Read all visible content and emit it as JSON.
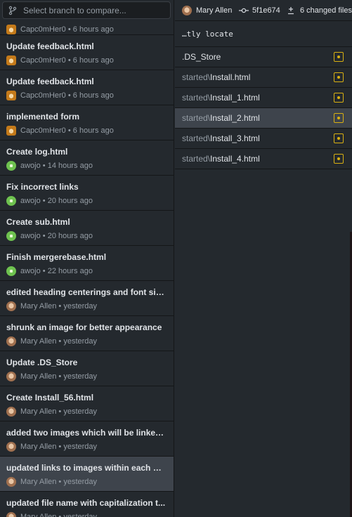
{
  "branch_selector": {
    "placeholder": "Select branch to compare..."
  },
  "commits": [
    {
      "title": "",
      "author": "Capc0mHer0",
      "time": "6 hours ago",
      "avatar": "capc0mher0-avatar"
    },
    {
      "title": "Update feedback.html",
      "author": "Capc0mHer0",
      "time": "6 hours ago",
      "avatar": "capc0mher0-avatar"
    },
    {
      "title": "Update feedback.html",
      "author": "Capc0mHer0",
      "time": "6 hours ago",
      "avatar": "capc0mher0-avatar"
    },
    {
      "title": "implemented form",
      "author": "Capc0mHer0",
      "time": "6 hours ago",
      "avatar": "capc0mher0-avatar"
    },
    {
      "title": "Create log.html",
      "author": "awojo",
      "time": "14 hours ago",
      "avatar": "awojo-avatar"
    },
    {
      "title": "Fix incorrect links",
      "author": "awojo",
      "time": "20 hours ago",
      "avatar": "awojo-avatar"
    },
    {
      "title": "Create sub.html",
      "author": "awojo",
      "time": "20 hours ago",
      "avatar": "awojo-avatar"
    },
    {
      "title": "Finish mergerebase.html",
      "author": "awojo",
      "time": "22 hours ago",
      "avatar": "awojo-avatar"
    },
    {
      "title": "edited heading centerings and font siz...",
      "author": "Mary Allen",
      "time": "yesterday",
      "avatar": "mary-allen-avatar"
    },
    {
      "title": "shrunk an image for better appearance",
      "author": "Mary Allen",
      "time": "yesterday",
      "avatar": "mary-allen-avatar"
    },
    {
      "title": "Update .DS_Store",
      "author": "Mary Allen",
      "time": "yesterday",
      "avatar": "mary-allen-avatar"
    },
    {
      "title": "Create Install_56.html",
      "author": "Mary Allen",
      "time": "yesterday",
      "avatar": "mary-allen-avatar"
    },
    {
      "title": "added two images which will be linked ...",
      "author": "Mary Allen",
      "time": "yesterday",
      "avatar": "mary-allen-avatar"
    },
    {
      "title": "updated links to images within each of ...",
      "author": "Mary Allen",
      "time": "yesterday",
      "avatar": "mary-allen-avatar",
      "selected": true
    },
    {
      "title": "updated file name with capitalization t...",
      "author": "Mary Allen",
      "time": "yesterday",
      "avatar": "mary-allen-avatar"
    }
  ],
  "commit_detail": {
    "author": "Mary Allen",
    "sha": "5f1e674",
    "changed_files": "6 changed files",
    "summary": "…tly locate"
  },
  "files": [
    {
      "dir": "",
      "name": ".DS_Store",
      "status": "modified"
    },
    {
      "dir": "started\\",
      "name": "Install.html",
      "status": "modified"
    },
    {
      "dir": "started\\",
      "name": "Install_1.html",
      "status": "modified"
    },
    {
      "dir": "started\\",
      "name": "Install_2.html",
      "status": "modified",
      "selected": true
    },
    {
      "dir": "started\\",
      "name": "Install_3.html",
      "status": "modified"
    },
    {
      "dir": "started\\",
      "name": "Install_4.html",
      "status": "modified"
    }
  ],
  "colors": {
    "background": "#24292e",
    "selected_row": "#3e444c",
    "modified_status": "#d9b012"
  },
  "icons": {
    "branch": "git-branch-icon",
    "commit": "git-commit-icon",
    "diff": "diff-icon",
    "file_status": "file-modified-icon"
  }
}
